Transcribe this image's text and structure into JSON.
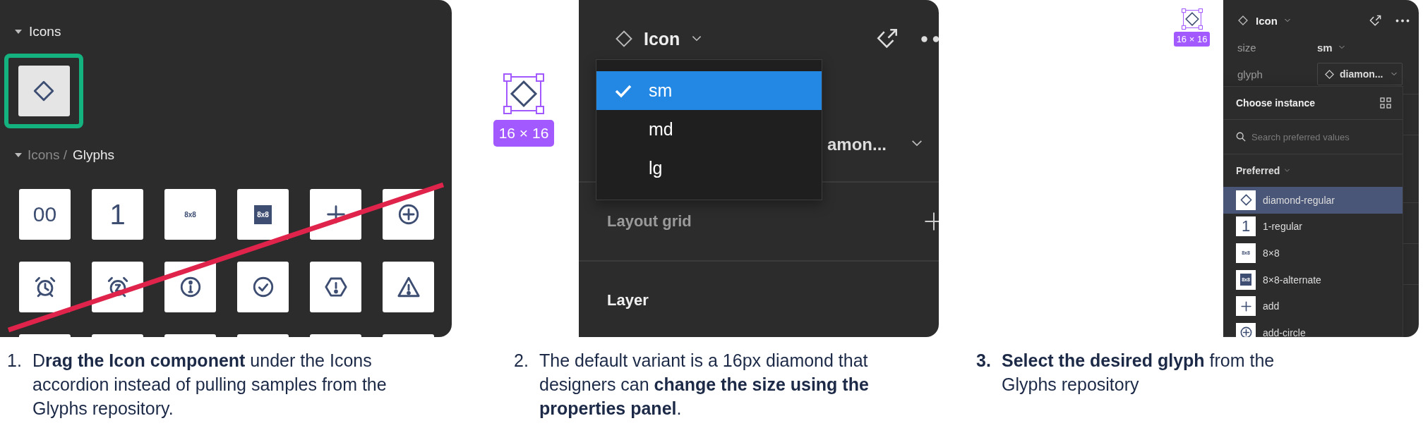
{
  "figure_1": {
    "section_1": {
      "title": "Icons",
      "expanded": true
    },
    "instance_tile": {
      "kind": "diamond",
      "selected": true
    },
    "section_2": {
      "parent": "Icons /",
      "title": "Glyphs",
      "expanded": true
    },
    "glyph_tiles": [
      {
        "kind": "text",
        "glyph": "00"
      },
      {
        "kind": "text-large",
        "glyph": "1"
      },
      {
        "kind": "text-small",
        "glyph": "8x8"
      },
      {
        "kind": "text-inverse",
        "glyph": "8x8"
      },
      {
        "kind": "plus"
      },
      {
        "kind": "plus-circle"
      },
      {
        "kind": "alarm"
      },
      {
        "kind": "alarm-snooze"
      },
      {
        "kind": "info"
      },
      {
        "kind": "check-circle"
      },
      {
        "kind": "hexagon-alert"
      },
      {
        "kind": "warning"
      },
      {
        "kind": "blank"
      },
      {
        "kind": "blank"
      },
      {
        "kind": "blank"
      },
      {
        "kind": "blank"
      },
      {
        "kind": "blank"
      },
      {
        "kind": "blank"
      }
    ],
    "struck_out": true
  },
  "figure_2": {
    "size_badge": "16 × 16",
    "header": {
      "title": "Icon"
    },
    "variant_menu": [
      {
        "label": "sm",
        "selected": true
      },
      {
        "label": "md",
        "selected": false
      },
      {
        "label": "lg",
        "selected": false
      }
    ],
    "glyph_value": "amon...",
    "sections": [
      {
        "label": "Layout grid",
        "empty": true
      },
      {
        "label": "Layer",
        "empty": false
      }
    ]
  },
  "figure_3": {
    "size_badge": "16 × 16",
    "header": {
      "title": "Icon"
    },
    "properties": [
      {
        "label": "size",
        "kind": "select",
        "value": "sm"
      },
      {
        "label": "glyph",
        "kind": "instance",
        "value": "diamon..."
      }
    ],
    "popup": {
      "title": "Choose instance",
      "search_placeholder": "Search preferred values",
      "group": "Preferred",
      "items": [
        {
          "label": "diamond-regular",
          "kind": "diamond",
          "selected": true
        },
        {
          "label": "1-regular",
          "kind": "text-large",
          "glyph": "1",
          "selected": false
        },
        {
          "label": "8×8",
          "kind": "text-small",
          "glyph": "8x8",
          "selected": false
        },
        {
          "label": "8×8-alternate",
          "kind": "text-inverse",
          "glyph": "8x8",
          "selected": false
        },
        {
          "label": "add",
          "kind": "plus",
          "selected": false
        },
        {
          "label": "add-circle",
          "kind": "plus-circle",
          "selected": false
        }
      ]
    }
  },
  "steps": [
    {
      "number": "1.",
      "bold_number": false,
      "text": "D**rag the Icon component** under the Icons accordion instead of pulling samples from the Glyphs repository."
    },
    {
      "number": "2.",
      "bold_number": false,
      "text": "The default variant is a 16px diamond that designers can **change the size using the properties panel**."
    },
    {
      "number": "3.",
      "bold_number": true,
      "text": "**Select the desired glyph** from the Glyphs repository"
    }
  ]
}
